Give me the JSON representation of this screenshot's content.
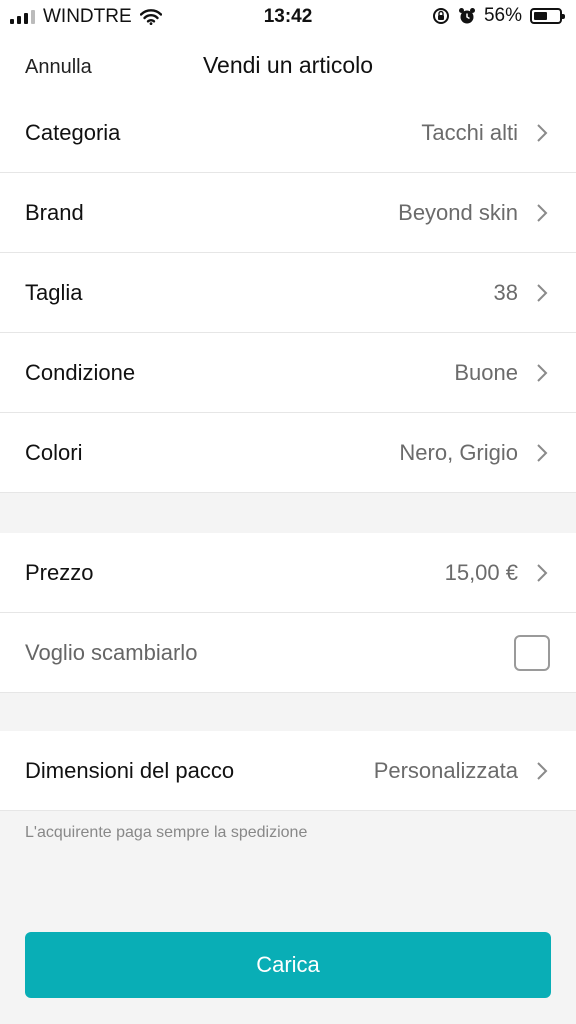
{
  "status_bar": {
    "carrier": "WINDTRE",
    "time": "13:42",
    "battery": "56%",
    "battery_level": 0.56,
    "icons": [
      "signal-icon",
      "wifi-icon",
      "orientation-lock-icon",
      "alarm-icon",
      "battery-icon"
    ]
  },
  "nav": {
    "cancel_label": "Annulla",
    "title": "Vendi un articolo"
  },
  "details": [
    {
      "label": "Categoria",
      "value": "Tacchi alti"
    },
    {
      "label": "Brand",
      "value": "Beyond skin"
    },
    {
      "label": "Taglia",
      "value": "38"
    },
    {
      "label": "Condizione",
      "value": "Buone"
    },
    {
      "label": "Colori",
      "value": "Nero, Grigio"
    }
  ],
  "price": {
    "label": "Prezzo",
    "value": "15,00 €"
  },
  "swap": {
    "label": "Voglio scambiarlo",
    "checked": false
  },
  "package": {
    "label": "Dimensioni del pacco",
    "value": "Personalizzata"
  },
  "shipping_note": "L'acquirente paga sempre la spedizione",
  "upload_button_label": "Carica",
  "colors": {
    "accent": "#09aeb6",
    "background": "#f4f4f4"
  }
}
